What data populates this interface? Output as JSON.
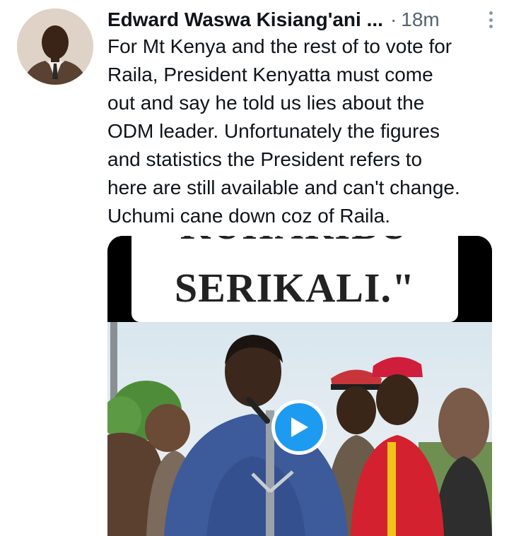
{
  "tweet": {
    "author_name": "Edward Waswa Kisiang'ani ...",
    "separator": "·",
    "timestamp": "18m",
    "more_icon": "more-vertical-icon",
    "text": "For Mt Kenya and the rest of to vote for\nRaila, President Kenyatta must come\nout and say he told us lies about the\nODM leader. Unfortunately the figures\nand statistics the President refers to\nhere are still available and can't change.\nUchumi cane down coz of Raila."
  },
  "media": {
    "caption_partial": "KUHARIBU",
    "caption_main": "SERIKALI.\"",
    "play_icon": "play-icon"
  },
  "colors": {
    "accent": "#1d9bf0",
    "text": "#0f1419",
    "secondary": "#536471"
  }
}
